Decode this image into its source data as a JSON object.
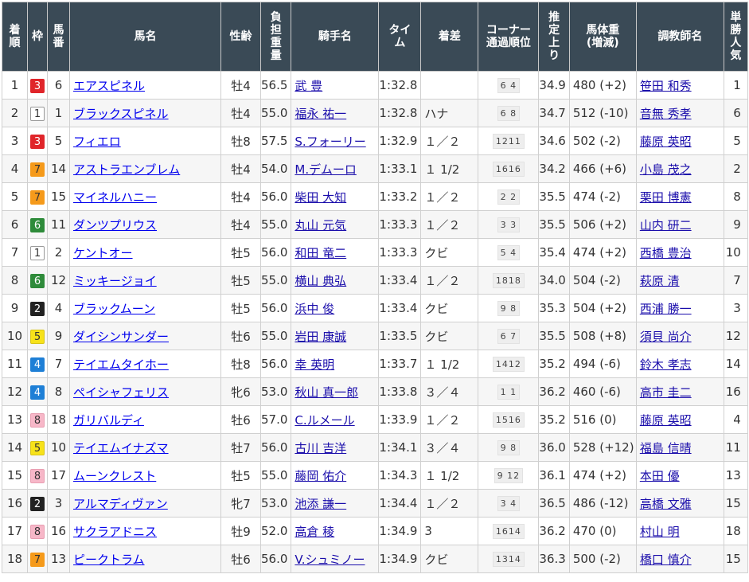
{
  "headers": {
    "finish": [
      "着",
      "順"
    ],
    "waku": [
      "枠"
    ],
    "umaban": [
      "馬",
      "番"
    ],
    "horse": [
      "馬名"
    ],
    "sexage": [
      "性齢"
    ],
    "weight": [
      "負",
      "担",
      "重",
      "量"
    ],
    "jockey": [
      "騎手名"
    ],
    "time": [
      "タイ",
      "ム"
    ],
    "margin": [
      "着差"
    ],
    "corner": [
      "コーナー",
      "通過順位"
    ],
    "last3f": [
      "推",
      "定",
      "上",
      "り"
    ],
    "body": [
      "馬体重",
      "(増減)"
    ],
    "trainer": [
      "調教師名"
    ],
    "pop": [
      "単",
      "勝",
      "人",
      "気"
    ]
  },
  "waku_colors": {
    "1": {
      "bg": "#ffffff",
      "fg": "#333333",
      "border": "#999999"
    },
    "2": {
      "bg": "#222222",
      "fg": "#ffffff",
      "border": "#222222"
    },
    "3": {
      "bg": "#e0252a",
      "fg": "#ffffff",
      "border": "#e0252a"
    },
    "4": {
      "bg": "#1e7fd6",
      "fg": "#ffffff",
      "border": "#1e7fd6"
    },
    "5": {
      "bg": "#f7e21a",
      "fg": "#333333",
      "border": "#d8c418"
    },
    "6": {
      "bg": "#2e8b3a",
      "fg": "#ffffff",
      "border": "#2e8b3a"
    },
    "7": {
      "bg": "#f59a1b",
      "fg": "#333333",
      "border": "#f59a1b"
    },
    "8": {
      "bg": "#f7b7c8",
      "fg": "#333333",
      "border": "#e89fb2"
    }
  },
  "rows": [
    {
      "finish": "1",
      "waku": "3",
      "umaban": "6",
      "horse": "エアスピネル",
      "sexage": "牡4",
      "weight": "56.5",
      "jockey": "武 豊",
      "time": "1:32.8",
      "margin": "",
      "corner": "6 4",
      "last3f": "34.9",
      "body": "480 (+2)",
      "trainer": "笹田 和秀",
      "pop": "1"
    },
    {
      "finish": "2",
      "waku": "1",
      "umaban": "1",
      "horse": "ブラックスピネル",
      "sexage": "牡4",
      "weight": "55.0",
      "jockey": "福永 祐一",
      "time": "1:32.8",
      "margin": "ハナ",
      "corner": "6 8",
      "last3f": "34.7",
      "body": "512 (-10)",
      "trainer": "音無 秀孝",
      "pop": "6"
    },
    {
      "finish": "3",
      "waku": "3",
      "umaban": "5",
      "horse": "フィエロ",
      "sexage": "牡8",
      "weight": "57.5",
      "jockey": "S.フォーリー",
      "time": "1:32.9",
      "margin": "１／２",
      "corner": "1211",
      "last3f": "34.6",
      "body": "502 (-2)",
      "trainer": "藤原 英昭",
      "pop": "5"
    },
    {
      "finish": "4",
      "waku": "7",
      "umaban": "14",
      "horse": "アストラエンブレム",
      "sexage": "牡4",
      "weight": "54.0",
      "jockey": "M.デムーロ",
      "time": "1:33.1",
      "margin": "１ 1/2",
      "corner": "1616",
      "last3f": "34.2",
      "body": "466 (+6)",
      "trainer": "小島 茂之",
      "pop": "2"
    },
    {
      "finish": "5",
      "waku": "7",
      "umaban": "15",
      "horse": "マイネルハニー",
      "sexage": "牡4",
      "weight": "56.0",
      "jockey": "柴田 大知",
      "time": "1:33.2",
      "margin": "１／２",
      "corner": "2 2",
      "last3f": "35.5",
      "body": "474 (-2)",
      "trainer": "栗田 博憲",
      "pop": "8"
    },
    {
      "finish": "6",
      "waku": "6",
      "umaban": "11",
      "horse": "ダンツプリウス",
      "sexage": "牡4",
      "weight": "55.0",
      "jockey": "丸山 元気",
      "time": "1:33.3",
      "margin": "１／２",
      "corner": "3 3",
      "last3f": "35.5",
      "body": "506 (+2)",
      "trainer": "山内 研二",
      "pop": "9"
    },
    {
      "finish": "7",
      "waku": "1",
      "umaban": "2",
      "horse": "ケントオー",
      "sexage": "牡5",
      "weight": "56.0",
      "jockey": "和田 竜二",
      "time": "1:33.3",
      "margin": "クビ",
      "corner": "5 4",
      "last3f": "35.4",
      "body": "474 (+2)",
      "trainer": "西橋 豊治",
      "pop": "10"
    },
    {
      "finish": "8",
      "waku": "6",
      "umaban": "12",
      "horse": "ミッキージョイ",
      "sexage": "牡5",
      "weight": "55.0",
      "jockey": "横山 典弘",
      "time": "1:33.4",
      "margin": "１／２",
      "corner": "1818",
      "last3f": "34.0",
      "body": "504 (-2)",
      "trainer": "萩原 清",
      "pop": "7"
    },
    {
      "finish": "9",
      "waku": "2",
      "umaban": "4",
      "horse": "ブラックムーン",
      "sexage": "牡5",
      "weight": "56.0",
      "jockey": "浜中 俊",
      "time": "1:33.4",
      "margin": "クビ",
      "corner": "9 8",
      "last3f": "35.3",
      "body": "504 (+2)",
      "trainer": "西浦 勝一",
      "pop": "3"
    },
    {
      "finish": "10",
      "waku": "5",
      "umaban": "9",
      "horse": "ダイシンサンダー",
      "sexage": "牡6",
      "weight": "55.0",
      "jockey": "岩田 康誠",
      "time": "1:33.5",
      "margin": "クビ",
      "corner": "6 7",
      "last3f": "35.5",
      "body": "508 (+8)",
      "trainer": "須貝 尚介",
      "pop": "12"
    },
    {
      "finish": "11",
      "waku": "4",
      "umaban": "7",
      "horse": "テイエムタイホー",
      "sexage": "牡8",
      "weight": "56.0",
      "jockey": "幸 英明",
      "time": "1:33.7",
      "margin": "１ 1/2",
      "corner": "1412",
      "last3f": "35.2",
      "body": "494 (-6)",
      "trainer": "鈴木 孝志",
      "pop": "14"
    },
    {
      "finish": "12",
      "waku": "4",
      "umaban": "8",
      "horse": "ペイシャフェリス",
      "sexage": "牝6",
      "weight": "53.0",
      "jockey": "秋山 真一郎",
      "time": "1:33.8",
      "margin": "３／４",
      "corner": "1 1",
      "last3f": "36.2",
      "body": "460 (-6)",
      "trainer": "高市 圭二",
      "pop": "16"
    },
    {
      "finish": "13",
      "waku": "8",
      "umaban": "18",
      "horse": "ガリバルディ",
      "sexage": "牡6",
      "weight": "57.0",
      "jockey": "C.ルメール",
      "time": "1:33.9",
      "margin": "１／２",
      "corner": "1516",
      "last3f": "35.2",
      "body": "516 (0)",
      "trainer": "藤原 英昭",
      "pop": "4"
    },
    {
      "finish": "14",
      "waku": "5",
      "umaban": "10",
      "horse": "テイエムイナズマ",
      "sexage": "牡7",
      "weight": "56.0",
      "jockey": "古川 吉洋",
      "time": "1:34.1",
      "margin": "３／４",
      "corner": "9 8",
      "last3f": "36.0",
      "body": "528 (+12)",
      "trainer": "福島 信晴",
      "pop": "11"
    },
    {
      "finish": "15",
      "waku": "8",
      "umaban": "17",
      "horse": "ムーンクレスト",
      "sexage": "牡5",
      "weight": "55.0",
      "jockey": "藤岡 佑介",
      "time": "1:34.3",
      "margin": "１ 1/2",
      "corner": "9 12",
      "last3f": "36.1",
      "body": "474 (+2)",
      "trainer": "本田 優",
      "pop": "13"
    },
    {
      "finish": "16",
      "waku": "2",
      "umaban": "3",
      "horse": "アルマディヴァン",
      "sexage": "牝7",
      "weight": "53.0",
      "jockey": "池添 謙一",
      "time": "1:34.4",
      "margin": "１／２",
      "corner": "3 4",
      "last3f": "36.5",
      "body": "486 (-12)",
      "trainer": "高橋 文雅",
      "pop": "15"
    },
    {
      "finish": "17",
      "waku": "8",
      "umaban": "16",
      "horse": "サクラアドニス",
      "sexage": "牡9",
      "weight": "52.0",
      "jockey": "高倉 稜",
      "time": "1:34.9",
      "margin": "3",
      "corner": "1614",
      "last3f": "36.2",
      "body": "470 (0)",
      "trainer": "村山 明",
      "pop": "18"
    },
    {
      "finish": "18",
      "waku": "7",
      "umaban": "13",
      "horse": "ピークトラム",
      "sexage": "牡6",
      "weight": "56.0",
      "jockey": "V.シュミノー",
      "time": "1:34.9",
      "margin": "クビ",
      "corner": "1314",
      "last3f": "36.3",
      "body": "500 (-2)",
      "trainer": "橋口 慎介",
      "pop": "15"
    }
  ]
}
